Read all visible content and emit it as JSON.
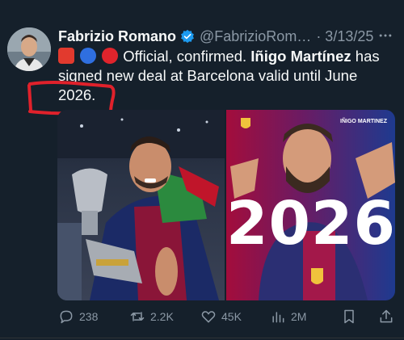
{
  "author": {
    "name": "Fabrizio Romano",
    "handle": "@FabrizioRom…",
    "date": "· 3/13/25"
  },
  "tweet": {
    "line1_text": "Official, confirmed. ",
    "line1_bold": "Iñigo Martínez",
    "line1_tail": " has",
    "line2": "signed new deal at Barcelona valid until June",
    "line3": "2026."
  },
  "media": {
    "image2_headline": "2026",
    "image2_caption": "IÑIGO MARTINEZ"
  },
  "actions": {
    "replies": "238",
    "reposts": "2.2K",
    "likes": "45K",
    "views": "2M"
  },
  "icons": [
    "verified-icon",
    "more-icon",
    "reply-icon",
    "repost-icon",
    "like-icon",
    "views-icon",
    "bookmark-icon",
    "share-icon"
  ],
  "colors": {
    "background": "#15202b",
    "text": "#f7f9f9",
    "secondary": "#8b98a5",
    "verified": "#1d9bf0",
    "annotation": "#e0212b"
  }
}
